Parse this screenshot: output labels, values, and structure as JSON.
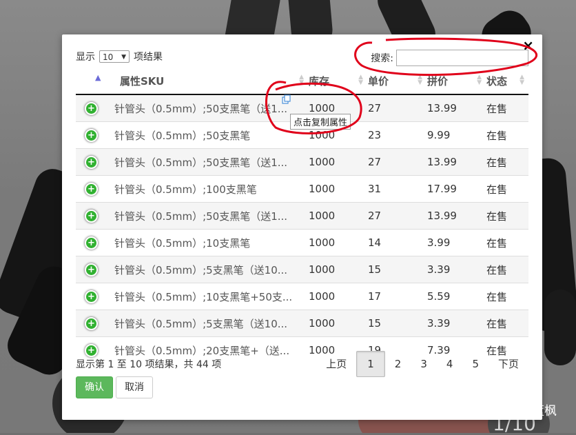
{
  "length_menu": {
    "prefix": "显示",
    "value": "10",
    "suffix": "项结果"
  },
  "search": {
    "label": "搜索:",
    "value": "",
    "placeholder": ""
  },
  "close_label": "×",
  "table": {
    "columns": [
      "属性SKU",
      "库存",
      "单价",
      "拼价",
      "状态"
    ],
    "rows": [
      {
        "sku": "针管头（0.5mm）;50支黑笔（送1...",
        "stock": "1000",
        "price": "27",
        "group_price": "13.99",
        "status": "在售"
      },
      {
        "sku": "针管头（0.5mm）;50支黑笔",
        "stock": "1000",
        "price": "23",
        "group_price": "9.99",
        "status": "在售"
      },
      {
        "sku": "针管头（0.5mm）;50支黑笔（送1...",
        "stock": "1000",
        "price": "27",
        "group_price": "13.99",
        "status": "在售"
      },
      {
        "sku": "针管头（0.5mm）;100支黑笔",
        "stock": "1000",
        "price": "31",
        "group_price": "17.99",
        "status": "在售"
      },
      {
        "sku": "针管头（0.5mm）;50支黑笔（送1...",
        "stock": "1000",
        "price": "27",
        "group_price": "13.99",
        "status": "在售"
      },
      {
        "sku": "针管头（0.5mm）;10支黑笔",
        "stock": "1000",
        "price": "14",
        "group_price": "3.99",
        "status": "在售"
      },
      {
        "sku": "针管头（0.5mm）;5支黑笔（送10...",
        "stock": "1000",
        "price": "15",
        "group_price": "3.39",
        "status": "在售"
      },
      {
        "sku": "针管头（0.5mm）;10支黑笔+50支...",
        "stock": "1000",
        "price": "17",
        "group_price": "5.59",
        "status": "在售"
      },
      {
        "sku": "针管头（0.5mm）;5支黑笔（送10...",
        "stock": "1000",
        "price": "15",
        "group_price": "3.39",
        "status": "在售"
      },
      {
        "sku": "针管头（0.5mm）;20支黑笔+（送...",
        "stock": "1000",
        "price": "19",
        "group_price": "7.39",
        "status": "在售"
      }
    ]
  },
  "tooltip": "点击复制属性",
  "footer": {
    "info": "显示第 1 至 10 项结果，共 44 项"
  },
  "pagination": {
    "prev": "上页",
    "pages": [
      "1",
      "2",
      "3",
      "4",
      "5"
    ],
    "active": "1",
    "next": "下页"
  },
  "buttons": {
    "confirm": "确认",
    "cancel": "取消"
  },
  "watermark": {
    "text": "蓝枫"
  },
  "page_indicator": "1/10",
  "colors": {
    "confirm": "#5cb85c",
    "annotation": "#e0001a",
    "add_icon": "#31b131",
    "sort_active": "#6b6bd8"
  }
}
